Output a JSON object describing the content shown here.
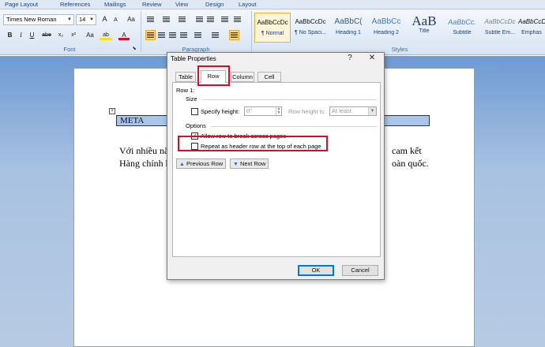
{
  "ribbon": {
    "tabs": [
      "Page Layout",
      "References",
      "Mailings",
      "Review",
      "View",
      "Design",
      "Layout"
    ],
    "font_name": "Times New Roman",
    "font_size": "14",
    "groups": {
      "font": "Font",
      "paragraph": "Paragraph",
      "styles": "Styles"
    },
    "buttons": {
      "grow": "A",
      "shrink": "A",
      "clear": "Aa",
      "bold": "B",
      "italic": "I",
      "underline": "U",
      "strike": "abe",
      "subscript": "x₂",
      "superscript": "x²",
      "change_case": "Aa",
      "highlight": "ab",
      "font_color": "A"
    },
    "styles": [
      {
        "sample": "AaBbCcDc",
        "name": "¶ Normal"
      },
      {
        "sample": "AaBbCcDc",
        "name": "¶ No Spaci..."
      },
      {
        "sample": "AaBbC(",
        "name": "Heading 1"
      },
      {
        "sample": "AaBbCc",
        "name": "Heading 2"
      },
      {
        "sample": "AaB",
        "name": "Title"
      },
      {
        "sample": "AaBbCc.",
        "name": "Subtitle"
      },
      {
        "sample": "AaBbCcDc",
        "name": "Subtle Em..."
      },
      {
        "sample": "AaBbCcDc",
        "name": "Emphas"
      }
    ],
    "colors": {
      "highlight": "#f7e11a",
      "font_color": "#d0102a"
    }
  },
  "document": {
    "table_cell": "META",
    "line1_left": "Với nhiều nă",
    "line1_right": "cam kết",
    "line2_left": "Hàng chính h",
    "line2_right": "oàn quốc."
  },
  "dialog": {
    "title": "Table Properties",
    "help": "?",
    "close": "✕",
    "tabs": [
      "Table",
      "Row",
      "Column",
      "Cell"
    ],
    "row_label": "Row 1:",
    "size_label": "Size",
    "specify_height_label": "Specify height:",
    "height_value": "0\"",
    "row_height_is_label": "Row height is:",
    "row_height_option": "At least",
    "options_label": "Options",
    "allow_break_label": "Allow row to break across pages",
    "allow_break_checked": true,
    "repeat_header_label": "Repeat as header row at the top of each page",
    "repeat_header_checked": false,
    "specify_height_checked": false,
    "previous_row": "Previous Row",
    "next_row": "Next Row",
    "ok": "OK",
    "cancel": "Cancel"
  },
  "annotation_color": "#d0102a"
}
